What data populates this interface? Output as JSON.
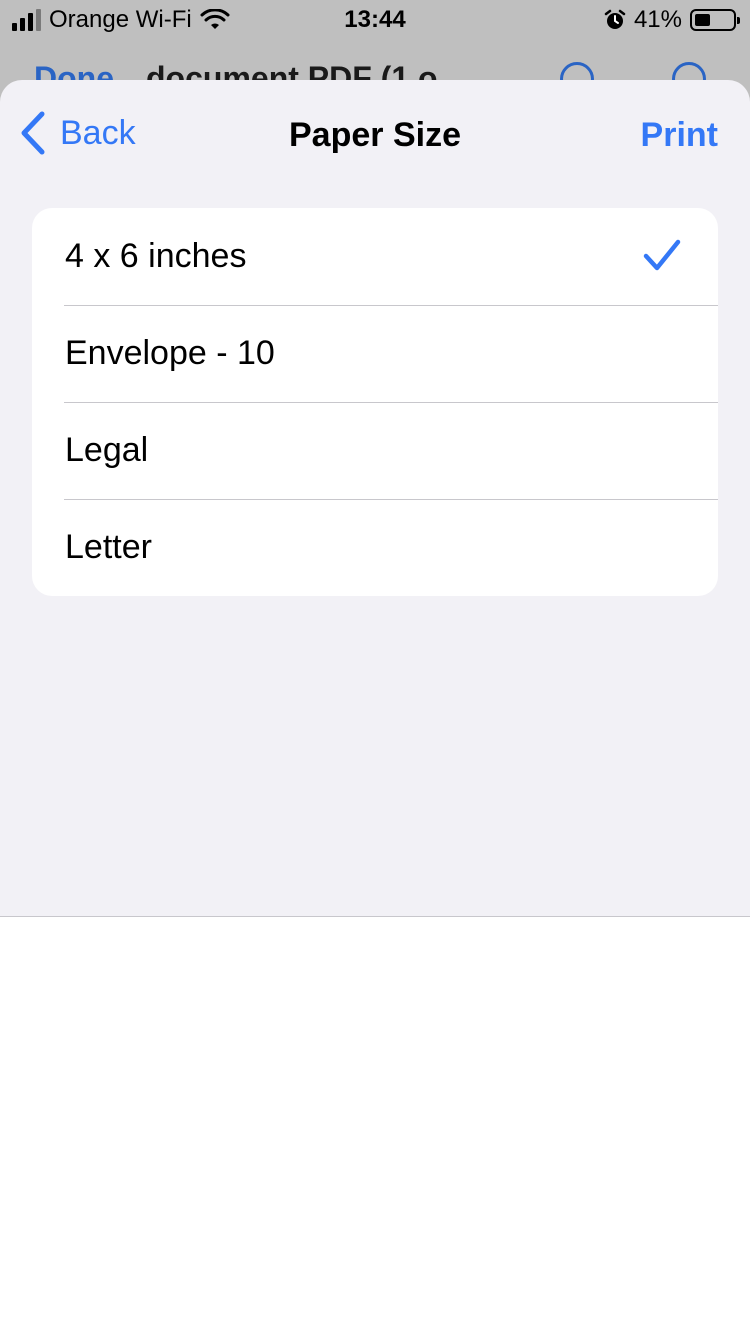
{
  "status_bar": {
    "carrier": "Orange Wi-Fi",
    "time": "13:44",
    "battery_percent": "41%",
    "battery_level": 0.41
  },
  "behind_toolbar": {
    "done_label": "Done",
    "title": "document PDF (1 o"
  },
  "nav": {
    "back_label": "Back",
    "title": "Paper Size",
    "print_label": "Print"
  },
  "paper_sizes": [
    {
      "label": "4 x 6 inches",
      "selected": true
    },
    {
      "label": "Envelope - 10",
      "selected": false
    },
    {
      "label": "Legal",
      "selected": false
    },
    {
      "label": "Letter",
      "selected": false
    }
  ],
  "colors": {
    "accent": "#3478f6",
    "sheet_background": "#f2f1f6",
    "separator": "#c8c7cc"
  },
  "icons": {
    "signal": "cellular-signal-icon",
    "wifi": "wifi-icon",
    "alarm": "alarm-clock-icon",
    "battery": "battery-icon",
    "back": "chevron-left-icon",
    "selected": "checkmark-icon"
  }
}
